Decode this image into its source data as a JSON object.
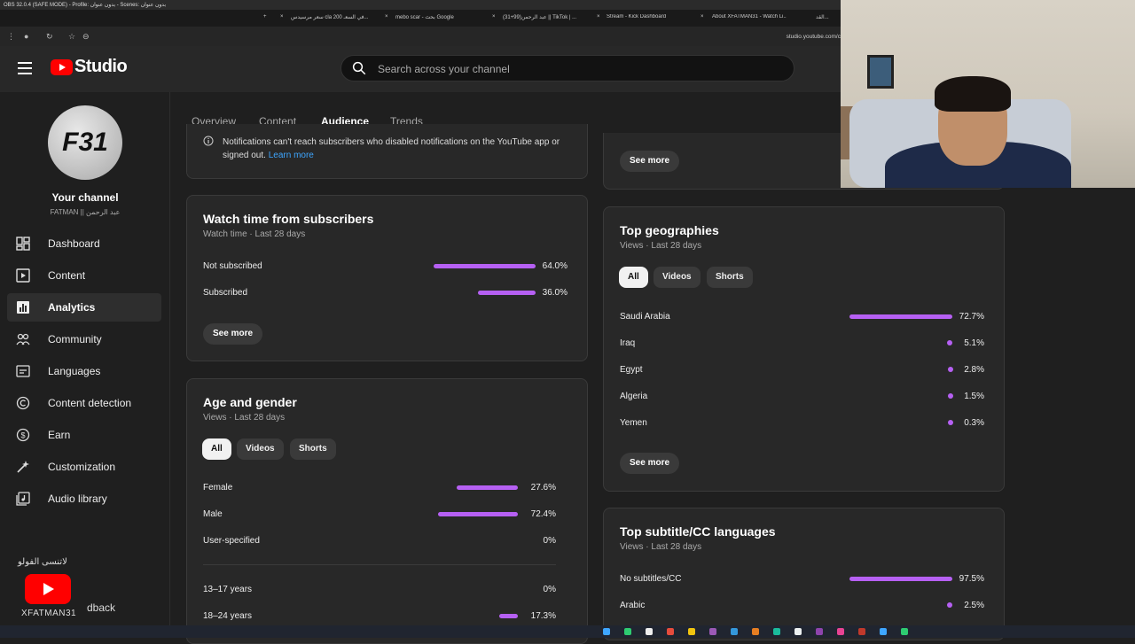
{
  "obs": {
    "title": "OBS 32.0.4 (SAFE MODE) - Profile: بدون عنوان - Scenes: بدون عنوان"
  },
  "browser": {
    "tabs": [
      "سعر مرسيدس cla 200 في السعـ...",
      "mebo scar - بحث Google",
      "(31+99)عبد الرحمن || TikTok | ...",
      "Stream - Kick Dashboard",
      "About XFATMAN31 - Watch Li...",
      "القد..."
    ],
    "url": "studio.youtube.com/c"
  },
  "header": {
    "logo_text": "Studio",
    "search_placeholder": "Search across your channel"
  },
  "sidebar": {
    "avatar_text": "F31",
    "channel_title": "Your channel",
    "channel_handle": "FATMAN || عبد الرحمن",
    "items": [
      {
        "label": "Dashboard",
        "icon": "dashboard-icon"
      },
      {
        "label": "Content",
        "icon": "content-icon"
      },
      {
        "label": "Analytics",
        "icon": "analytics-icon"
      },
      {
        "label": "Community",
        "icon": "community-icon"
      },
      {
        "label": "Languages",
        "icon": "languages-icon"
      },
      {
        "label": "Content detection",
        "icon": "copyright-icon"
      },
      {
        "label": "Earn",
        "icon": "earn-icon"
      },
      {
        "label": "Customization",
        "icon": "customization-icon"
      },
      {
        "label": "Audio library",
        "icon": "audio-library-icon"
      }
    ],
    "feedback_label": "dback",
    "sticker": {
      "arabic": "لاتنسى الفولو",
      "name": "XFATMAN31"
    }
  },
  "tabs": [
    "Overview",
    "Content",
    "Audience",
    "Trends"
  ],
  "notification_card": {
    "text_line1": "Notifications can't reach subscribers who disabled notifications on the YouTube app or",
    "text_line2": "signed out.",
    "link": "Learn more"
  },
  "watch_time_card": {
    "title": "Watch time from subscribers",
    "subtitle": "Watch time · Last 28 days",
    "rows": [
      {
        "label": "Not subscribed",
        "value": "64.0%",
        "fraction": 0.64
      },
      {
        "label": "Subscribed",
        "value": "36.0%",
        "fraction": 0.36
      }
    ],
    "see_more": "See more"
  },
  "age_gender_card": {
    "title": "Age and gender",
    "subtitle": "Views · Last 28 days",
    "chips": [
      "All",
      "Videos",
      "Shorts"
    ],
    "gender_rows": [
      {
        "label": "Female",
        "value": "27.6%",
        "fraction": 0.276
      },
      {
        "label": "Male",
        "value": "72.4%",
        "fraction": 0.724
      },
      {
        "label": "User-specified",
        "value": "0%",
        "fraction": 0
      }
    ],
    "age_rows": [
      {
        "label": "13–17 years",
        "value": "0%",
        "fraction": 0
      },
      {
        "label": "18–24 years",
        "value": "17.3%",
        "fraction": 0.173
      }
    ]
  },
  "top_right_card": {
    "see_more": "See more"
  },
  "geographies_card": {
    "title": "Top geographies",
    "subtitle": "Views · Last 28 days",
    "chips": [
      "All",
      "Videos",
      "Shorts"
    ],
    "rows": [
      {
        "label": "Saudi Arabia",
        "value": "72.7%",
        "fraction": 0.727
      },
      {
        "label": "Iraq",
        "value": "5.1%",
        "fraction": 0.051
      },
      {
        "label": "Egypt",
        "value": "2.8%",
        "fraction": 0.028
      },
      {
        "label": "Algeria",
        "value": "1.5%",
        "fraction": 0.015
      },
      {
        "label": "Yemen",
        "value": "0.3%",
        "fraction": 0.003
      }
    ],
    "see_more": "See more"
  },
  "subtitles_card": {
    "title": "Top subtitle/CC languages",
    "subtitle": "Views · Last 28 days",
    "rows": [
      {
        "label": "No subtitles/CC",
        "value": "97.5%",
        "fraction": 0.975
      },
      {
        "label": "Arabic",
        "value": "2.5%",
        "fraction": 0.025
      }
    ]
  },
  "colors": {
    "accent_bar": "#b660f3",
    "background": "#1f1f1f",
    "card": "#282828",
    "brand_red": "#ff0000"
  }
}
